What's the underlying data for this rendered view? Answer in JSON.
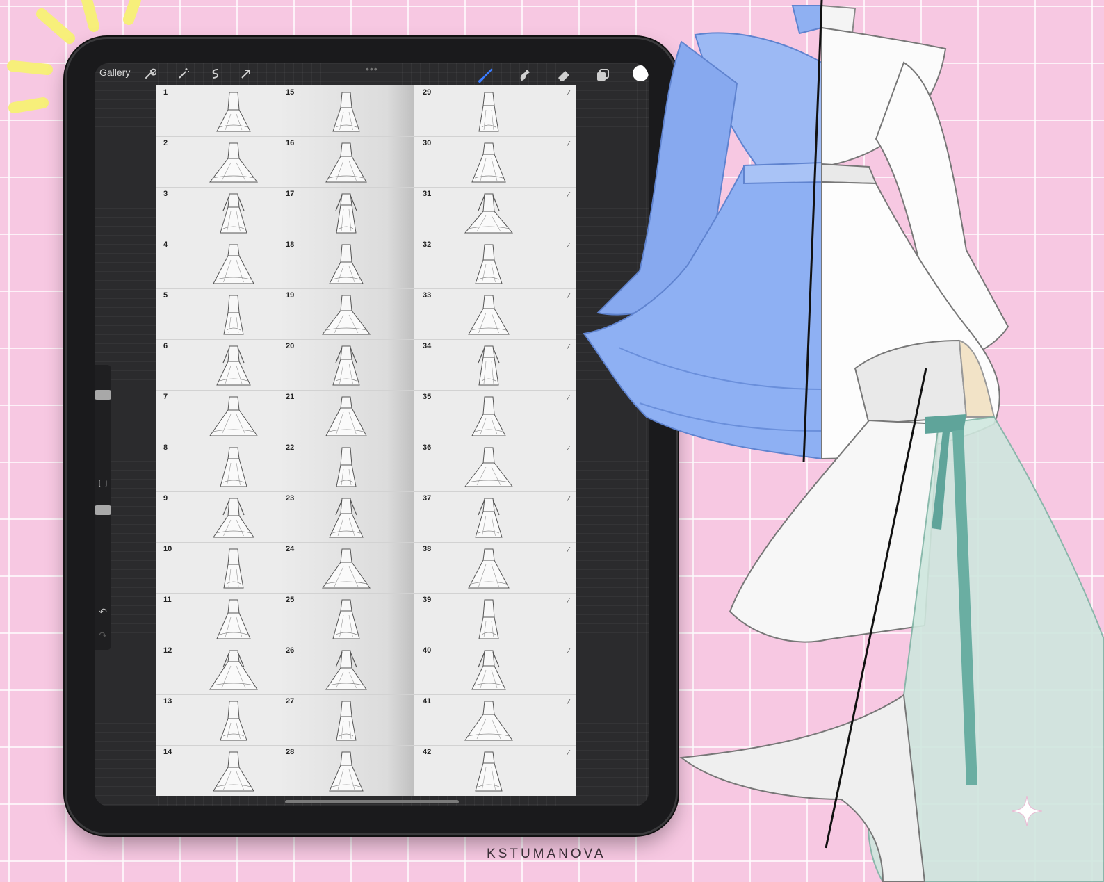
{
  "topbar": {
    "gallery_label": "Gallery",
    "left_icons": [
      "wrench-icon",
      "magic-wand-icon",
      "selection-icon",
      "transform-arrow-icon"
    ],
    "right_icons": [
      "brush-icon",
      "smudge-icon",
      "eraser-icon",
      "layers-icon",
      "color-picker"
    ]
  },
  "colors": {
    "accent_brush": "#3a7cff",
    "background": "#f7c8e2",
    "current_color": "#ffffff"
  },
  "brushes": {
    "column1": [
      "1",
      "2",
      "3",
      "4",
      "5",
      "6",
      "7",
      "8",
      "9",
      "10",
      "11",
      "12",
      "13",
      "14"
    ],
    "column2": [
      "15",
      "16",
      "17",
      "18",
      "19",
      "20",
      "21",
      "22",
      "23",
      "24",
      "25",
      "26",
      "27",
      "28"
    ],
    "column3": [
      "29",
      "30",
      "31",
      "32",
      "33",
      "34",
      "35",
      "36",
      "37",
      "38",
      "39",
      "40",
      "41",
      "42"
    ]
  },
  "credit": "KSTUMANOVA"
}
